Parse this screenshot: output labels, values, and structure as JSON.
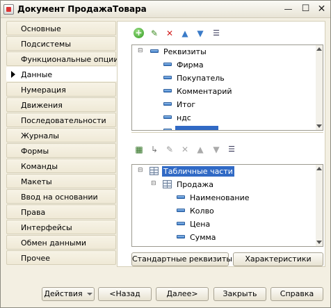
{
  "window": {
    "title": "Документ ПродажаТовара"
  },
  "nav": {
    "items": [
      {
        "label": "Основные"
      },
      {
        "label": "Подсистемы"
      },
      {
        "label": "Функциональные опции"
      },
      {
        "label": "Данные"
      },
      {
        "label": "Нумерация"
      },
      {
        "label": "Движения"
      },
      {
        "label": "Последовательности"
      },
      {
        "label": "Журналы"
      },
      {
        "label": "Формы"
      },
      {
        "label": "Команды"
      },
      {
        "label": "Макеты"
      },
      {
        "label": "Ввод на основании"
      },
      {
        "label": "Права"
      },
      {
        "label": "Интерфейсы"
      },
      {
        "label": "Обмен данными"
      },
      {
        "label": "Прочее"
      }
    ],
    "active": "Данные"
  },
  "requisites": {
    "root": "Реквизиты",
    "items": [
      "Фирма",
      "Покупатель",
      "Комментарий",
      "Итог",
      "ндс"
    ]
  },
  "tabular": {
    "root": "Табличные части",
    "section": "Продажа",
    "items": [
      "Наименование",
      "Колво",
      "Цена",
      "Сумма"
    ]
  },
  "buttons": {
    "standard_requisites": "Стандартные реквизиты",
    "characteristics": "Характеристики",
    "actions": "Действия",
    "back": "<Назад",
    "next": "Далее>",
    "close": "Закрыть",
    "help": "Справка"
  },
  "icons": {
    "toolbar1": [
      "add-icon",
      "edit-icon",
      "delete-icon",
      "move-up-icon",
      "move-down-icon",
      "sort-icon"
    ],
    "toolbar2": [
      "add-table-icon",
      "add-subitem-icon",
      "edit-icon",
      "delete-icon",
      "move-up-icon",
      "move-down-icon",
      "sort-icon"
    ]
  },
  "colors": {
    "selection": "#316ac5",
    "window_bg": "#f3efe2",
    "accent_blue": "#3a7bc8"
  }
}
